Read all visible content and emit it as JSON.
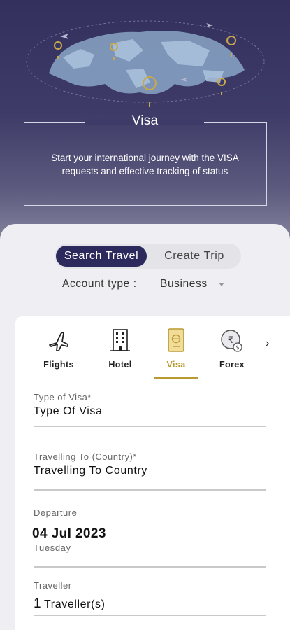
{
  "hero": {
    "title": "Visa",
    "description": "Start your international journey with the VISA requests and effective tracking of status"
  },
  "toggle": {
    "active_label": "Search Travel",
    "inactive_label": "Create Trip"
  },
  "account": {
    "label": "Account type :",
    "value": "Business"
  },
  "tabs": [
    {
      "label": "Flights",
      "icon": "airplane-icon",
      "active": false
    },
    {
      "label": "Hotel",
      "icon": "hotel-icon",
      "active": false
    },
    {
      "label": "Visa",
      "icon": "passport-icon",
      "active": true
    },
    {
      "label": "Forex",
      "icon": "currency-exchange-icon",
      "active": false
    }
  ],
  "form": {
    "visa_type": {
      "label": "Type of Visa*",
      "value": "Type Of Visa"
    },
    "travelling_to": {
      "label": "Travelling To (Country)*",
      "value": "Travelling To Country"
    },
    "departure": {
      "label": "Departure",
      "date": "04 Jul 2023",
      "day": "Tuesday"
    },
    "traveller": {
      "label": "Traveller",
      "count": "1",
      "unit": "Traveller(s)"
    }
  },
  "colors": {
    "hero_top": "#33305d",
    "active_toggle": "#2c2a5c",
    "accent_gold": "#b89a33"
  }
}
